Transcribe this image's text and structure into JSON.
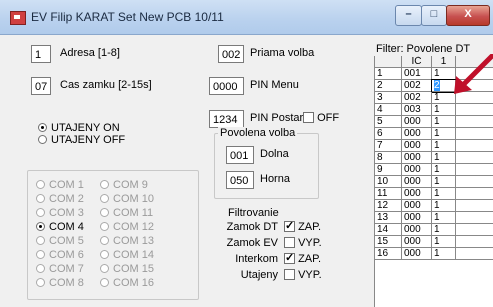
{
  "window": {
    "title": "EV Filip KARAT Set New PCB 10/11",
    "min": "–",
    "max": "□",
    "close": "X"
  },
  "fields": {
    "adresa": {
      "value": "1",
      "label": "Adresa [1-8]"
    },
    "cas": {
      "value": "07",
      "label": "Cas zamku [2-15s]"
    },
    "priama": {
      "value": "002",
      "label": "Priama volba"
    },
    "pin_menu": {
      "value": "0000",
      "label": "PIN Menu"
    },
    "pin_postar": {
      "value": "1234",
      "label": "PIN Postar",
      "off_label": "OFF"
    }
  },
  "utajeny": {
    "on": "UTAJENY ON",
    "off": "UTAJENY OFF"
  },
  "com": {
    "left": [
      "COM 1",
      "COM 2",
      "COM 3",
      "COM 4",
      "COM 5",
      "COM 6",
      "COM 7",
      "COM 8"
    ],
    "right": [
      "COM 9",
      "COM 10",
      "COM 11",
      "COM 12",
      "COM 13",
      "COM 14",
      "COM 15",
      "COM 16"
    ],
    "selected": "COM 4"
  },
  "povolena": {
    "title": "Povolena volba",
    "dolna_value": "001",
    "dolna_label": "Dolna",
    "horna_value": "050",
    "horna_label": "Horna"
  },
  "filtrovanie": {
    "title": "Filtrovanie",
    "items": [
      {
        "label": "Zamok DT",
        "checked": true,
        "state": "ZAP."
      },
      {
        "label": "Zamok EV",
        "checked": false,
        "state": "VYP."
      },
      {
        "label": "Interkom",
        "checked": true,
        "state": "ZAP."
      },
      {
        "label": "Utajeny",
        "checked": false,
        "state": "VYP."
      }
    ]
  },
  "filter_grid": {
    "title": "Filter: Povolene DT",
    "headers": [
      "",
      "IČ",
      "1"
    ],
    "rows": [
      [
        "1",
        "001",
        "1"
      ],
      [
        "2",
        "002",
        "2"
      ],
      [
        "3",
        "002",
        "1"
      ],
      [
        "4",
        "003",
        "1"
      ],
      [
        "5",
        "000",
        "1"
      ],
      [
        "6",
        "000",
        "1"
      ],
      [
        "7",
        "000",
        "1"
      ],
      [
        "8",
        "000",
        "1"
      ],
      [
        "9",
        "000",
        "1"
      ],
      [
        "10",
        "000",
        "1"
      ],
      [
        "11",
        "000",
        "1"
      ],
      [
        "12",
        "000",
        "1"
      ],
      [
        "13",
        "000",
        "1"
      ],
      [
        "14",
        "000",
        "1"
      ],
      [
        "15",
        "000",
        "1"
      ],
      [
        "16",
        "000",
        "1"
      ]
    ],
    "selected_row": 1
  },
  "accent": {
    "selection": "#3399ff",
    "arrow": "#c0102a"
  }
}
